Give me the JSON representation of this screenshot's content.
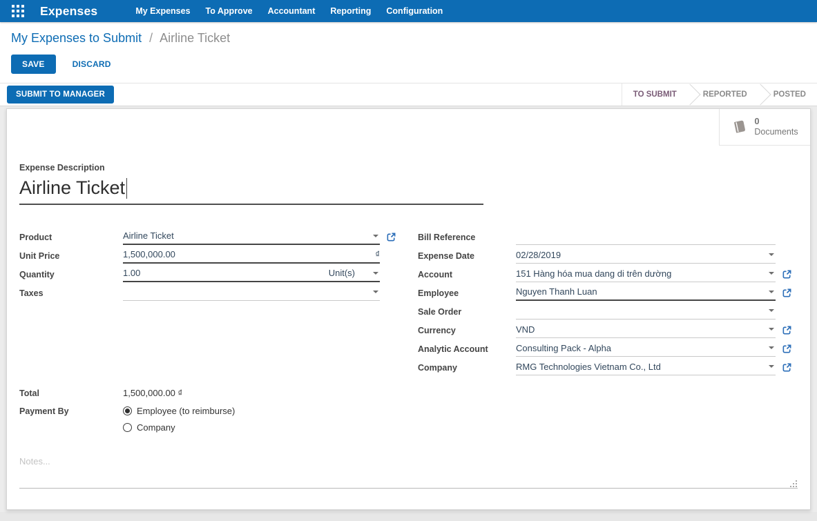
{
  "nav": {
    "app_name": "Expenses",
    "items": [
      {
        "label": "My Expenses"
      },
      {
        "label": "To Approve"
      },
      {
        "label": "Accountant"
      },
      {
        "label": "Reporting"
      },
      {
        "label": "Configuration"
      }
    ]
  },
  "breadcrumb": {
    "parent": "My Expenses to Submit",
    "separator": "/",
    "current": "Airline Ticket"
  },
  "actions": {
    "save": "SAVE",
    "discard": "DISCARD"
  },
  "statusbar": {
    "action": "SUBMIT TO MANAGER",
    "steps": [
      {
        "label": "TO SUBMIT",
        "active": true
      },
      {
        "label": "REPORTED",
        "active": false
      },
      {
        "label": "POSTED",
        "active": false
      }
    ]
  },
  "button_box": {
    "documents_count": "0",
    "documents_label": "Documents"
  },
  "form": {
    "description_label": "Expense Description",
    "description_value": "Airline Ticket",
    "left": [
      {
        "label": "Product",
        "value": "Airline Ticket"
      },
      {
        "label": "Unit Price",
        "value": "1,500,000.00",
        "suffix": "₫"
      },
      {
        "label": "Quantity",
        "value": "1.00",
        "uom": "Unit(s)"
      },
      {
        "label": "Taxes",
        "value": ""
      }
    ],
    "right": [
      {
        "label": "Bill Reference",
        "value": ""
      },
      {
        "label": "Expense Date",
        "value": "02/28/2019"
      },
      {
        "label": "Account",
        "value": "151 Hàng hóa mua dang di trên dường"
      },
      {
        "label": "Employee",
        "value": "Nguyen Thanh Luan"
      },
      {
        "label": "Sale Order",
        "value": ""
      },
      {
        "label": "Currency",
        "value": "VND"
      },
      {
        "label": "Analytic Account",
        "value": "Consulting Pack - Alpha"
      },
      {
        "label": "Company",
        "value": "RMG Technologies Vietnam Co., Ltd"
      }
    ],
    "total": {
      "label": "Total",
      "value": "1,500,000.00 ₫"
    },
    "payment": {
      "label": "Payment By",
      "options": [
        {
          "label": "Employee (to reimburse)",
          "selected": true
        },
        {
          "label": "Company",
          "selected": false
        }
      ]
    },
    "notes_placeholder": "Notes..."
  },
  "colors": {
    "navbar": "#0d6cb4",
    "primary_button": "#0d6cb4",
    "breadcrumb_link": "#0d6cb4",
    "status_active": "#7a5c77",
    "status_inactive": "#8a8a8a"
  }
}
